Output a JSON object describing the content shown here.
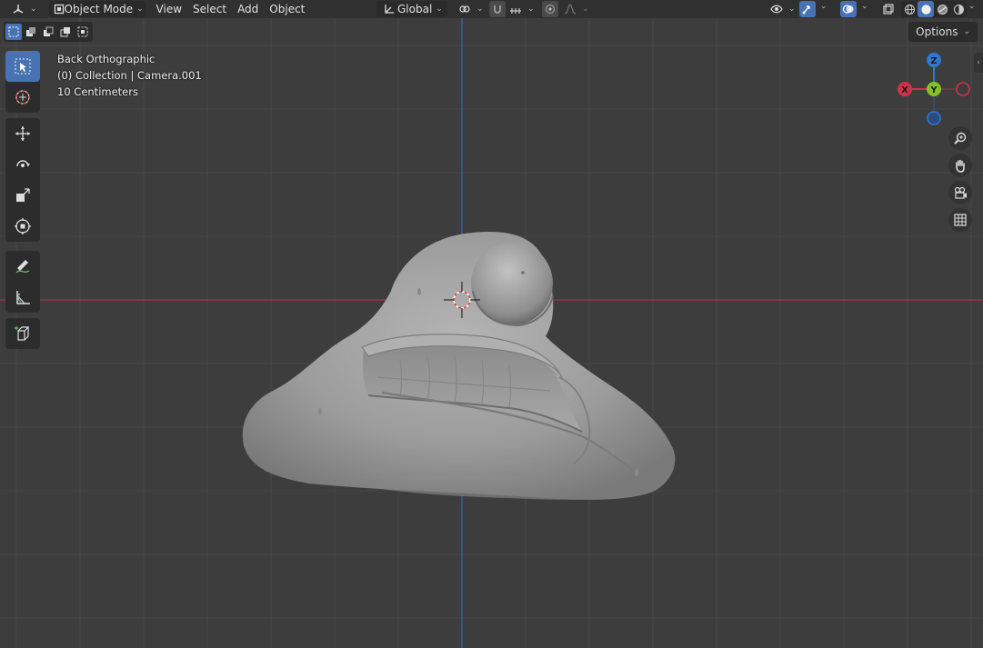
{
  "header": {
    "editor_type_icon": "3d-viewport-icon",
    "mode_label": "Object Mode",
    "menus": [
      "View",
      "Select",
      "Add",
      "Object"
    ],
    "transform_orientation": "Global",
    "shading_modes": [
      "wireframe",
      "solid",
      "material-preview",
      "rendered"
    ],
    "active_shading": "solid"
  },
  "viewport": {
    "options_label": "Options",
    "info": {
      "view_name": "Back Orthographic",
      "collection": "(0) Collection | Camera.001",
      "scale": "10 Centimeters"
    },
    "gizmo": {
      "x_label": "X",
      "y_label": "Y",
      "z_label": "Z",
      "x_color": "#d0324a",
      "y_color": "#84c128",
      "z_color": "#2f78d0"
    },
    "toolbar": [
      "select-box",
      "cursor",
      "move",
      "rotate",
      "scale",
      "transform",
      "annotate",
      "measure",
      "add-cube"
    ],
    "active_tool": "select-box"
  },
  "colors": {
    "header_bg": "#303030",
    "viewport_bg": "#3d3d3d",
    "accent": "#4772b3",
    "x_axis_line": "#9c3a42",
    "z_axis_line": "#3a66a8"
  }
}
